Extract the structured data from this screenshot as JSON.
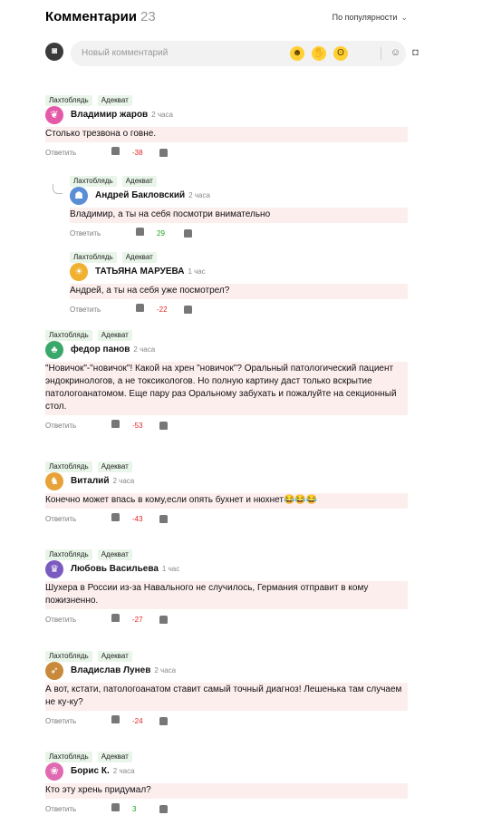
{
  "header": {
    "title": "Комментарии",
    "count": "23",
    "sort_label": "По популярности"
  },
  "compose": {
    "placeholder": "Новый комментарий"
  },
  "comments": [
    {
      "tags": [
        "Лахтоблядь",
        "Адекват"
      ],
      "author": "Владимир жаров",
      "time": "2 часа",
      "text": "Столько трезвона о говне.",
      "reply_label": "Ответить",
      "score": "-38",
      "avatar_color": "#e55aa8"
    },
    {
      "tags": [
        "Лахтоблядь",
        "Адекват"
      ],
      "author": "Андрей Бакловский",
      "time": "2 часа",
      "text": "Владимир, а ты на себя посмотри внимательно",
      "reply_label": "Ответить",
      "score": "29",
      "avatar_color": "#5a8fd6"
    },
    {
      "tags": [
        "Лахтоблядь",
        "Адекват"
      ],
      "author": "ТАТЬЯНА МАРУЕВА",
      "time": "1 час",
      "text": "Андрей, а ты на себя уже посмотрел?",
      "reply_label": "Ответить",
      "score": "-22",
      "avatar_color": "#f0b030"
    },
    {
      "tags": [
        "Лахтоблядь",
        "Адекват"
      ],
      "author": "федор панов",
      "time": "2 часа",
      "text": "\"Новичок\"-\"новичок\"! Какой на хрен \"новичок\"? Оральный патологический пациент эндокринологов, а не токсикологов. Но полную картину даст только вскрытие патологоанатомом. Еще пару раз Оральному забухать и пожалуйте на секционный стол.",
      "reply_label": "Ответить",
      "score": "-53",
      "avatar_color": "#3aa86a"
    },
    {
      "tags": [
        "Лахтоблядь",
        "Адекват"
      ],
      "author": "Виталий",
      "time": "2 часа",
      "text": "Конечно может впась в кому,если опять бухнет и нюхнет😂😂😂",
      "reply_label": "Ответить",
      "score": "-43",
      "avatar_color": "#e8a23a"
    },
    {
      "tags": [
        "Лахтоблядь",
        "Адекват"
      ],
      "author": "Любовь Васильева",
      "time": "1 час",
      "text": "Шухера в России из-за Навального не случилось, Германия отправит в кому пожизненно.",
      "reply_label": "Ответить",
      "score": "-27",
      "avatar_color": "#7a5bbf"
    },
    {
      "tags": [
        "Лахтоблядь",
        "Адекват"
      ],
      "author": "Владислав Лунев",
      "time": "2 часа",
      "text": "А вот, кстати, патологоанатом ставит самый точный диагноз! Лешенька там случаем не ку-ку?",
      "reply_label": "Ответить",
      "score": "-24",
      "avatar_color": "#c88a3a"
    },
    {
      "tags": [
        "Лахтоблядь",
        "Адекват"
      ],
      "author": "Борис К.",
      "time": "2 часа",
      "text": "Кто эту хрень придумал?",
      "reply_label": "Ответить",
      "score": "3",
      "avatar_color": "#e06ab2"
    }
  ]
}
